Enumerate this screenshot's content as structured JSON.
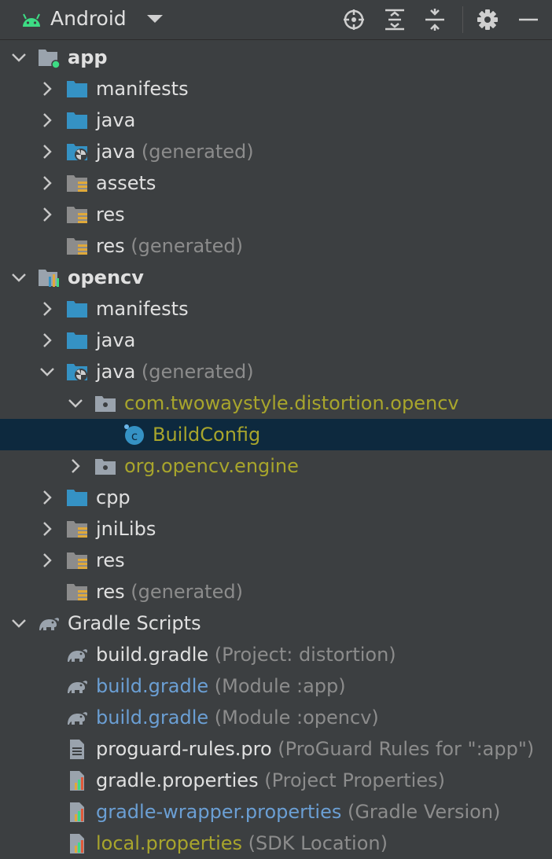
{
  "toolbar": {
    "title": "Android",
    "buttons": [
      "locate-icon",
      "expand-all-icon",
      "collapse-all-icon",
      "gear-icon",
      "minimize-icon"
    ]
  },
  "colors": {
    "background": "#3c3f41",
    "selection": "#0d293e",
    "folder_blue": "#3592c4",
    "package_text": "#a8a52c",
    "modified_blue": "#6b9fd4",
    "hint_gray": "#8c8c8c",
    "android_green": "#3ddc84"
  },
  "tree": [
    {
      "name": "app",
      "hint": "",
      "level": 0,
      "arrow": "down",
      "icon": "module-icon",
      "style": "bold"
    },
    {
      "name": "manifests",
      "hint": "",
      "level": 1,
      "arrow": "right",
      "icon": "folder-icon",
      "style": "normal"
    },
    {
      "name": "java",
      "hint": "",
      "level": 1,
      "arrow": "right",
      "icon": "folder-icon",
      "style": "normal"
    },
    {
      "name": "java",
      "hint": "(generated)",
      "level": 1,
      "arrow": "right",
      "icon": "generated-folder-icon",
      "style": "normal"
    },
    {
      "name": "assets",
      "hint": "",
      "level": 1,
      "arrow": "right",
      "icon": "resource-folder-icon",
      "style": "normal"
    },
    {
      "name": "res",
      "hint": "",
      "level": 1,
      "arrow": "right",
      "icon": "resource-folder-icon",
      "style": "normal"
    },
    {
      "name": "res",
      "hint": "(generated)",
      "level": 1,
      "arrow": "none",
      "icon": "resource-folder-icon",
      "style": "normal"
    },
    {
      "name": "opencv",
      "hint": "",
      "level": 0,
      "arrow": "down",
      "icon": "library-module-icon",
      "style": "bold"
    },
    {
      "name": "manifests",
      "hint": "",
      "level": 1,
      "arrow": "right",
      "icon": "folder-icon",
      "style": "normal"
    },
    {
      "name": "java",
      "hint": "",
      "level": 1,
      "arrow": "right",
      "icon": "folder-icon",
      "style": "normal"
    },
    {
      "name": "java",
      "hint": "(generated)",
      "level": 1,
      "arrow": "down",
      "icon": "generated-folder-icon",
      "style": "normal"
    },
    {
      "name": "com.twowaystyle.distortion.opencv",
      "hint": "",
      "level": 2,
      "arrow": "down",
      "icon": "package-icon",
      "style": "package"
    },
    {
      "name": "BuildConfig",
      "hint": "",
      "level": 3,
      "arrow": "none",
      "icon": "class-icon",
      "style": "package",
      "selected": true
    },
    {
      "name": "org.opencv.engine",
      "hint": "",
      "level": 2,
      "arrow": "right",
      "icon": "package-icon",
      "style": "package"
    },
    {
      "name": "cpp",
      "hint": "",
      "level": 1,
      "arrow": "right",
      "icon": "folder-icon",
      "style": "normal"
    },
    {
      "name": "jniLibs",
      "hint": "",
      "level": 1,
      "arrow": "right",
      "icon": "resource-folder-icon",
      "style": "normal"
    },
    {
      "name": "res",
      "hint": "",
      "level": 1,
      "arrow": "right",
      "icon": "resource-folder-icon",
      "style": "normal"
    },
    {
      "name": "res",
      "hint": "(generated)",
      "level": 1,
      "arrow": "none",
      "icon": "resource-folder-icon",
      "style": "normal"
    },
    {
      "name": "Gradle Scripts",
      "hint": "",
      "level": 0,
      "arrow": "down",
      "icon": "gradle-icon",
      "style": "normal"
    },
    {
      "name": "build.gradle",
      "hint": "(Project: distortion)",
      "level": 1,
      "arrow": "none",
      "icon": "gradle-icon",
      "style": "normal"
    },
    {
      "name": "build.gradle",
      "hint": "(Module :app)",
      "level": 1,
      "arrow": "none",
      "icon": "gradle-icon",
      "style": "blue"
    },
    {
      "name": "build.gradle",
      "hint": "(Module :opencv)",
      "level": 1,
      "arrow": "none",
      "icon": "gradle-icon",
      "style": "blue"
    },
    {
      "name": "proguard-rules.pro",
      "hint": "(ProGuard Rules for \":app\")",
      "level": 1,
      "arrow": "none",
      "icon": "text-file-icon",
      "style": "normal"
    },
    {
      "name": "gradle.properties",
      "hint": "(Project Properties)",
      "level": 1,
      "arrow": "none",
      "icon": "properties-file-icon",
      "style": "normal"
    },
    {
      "name": "gradle-wrapper.properties",
      "hint": "(Gradle Version)",
      "level": 1,
      "arrow": "none",
      "icon": "properties-file-icon",
      "style": "blue"
    },
    {
      "name": "local.properties",
      "hint": "(SDK Location)",
      "level": 1,
      "arrow": "none",
      "icon": "properties-file-icon",
      "style": "package"
    }
  ]
}
